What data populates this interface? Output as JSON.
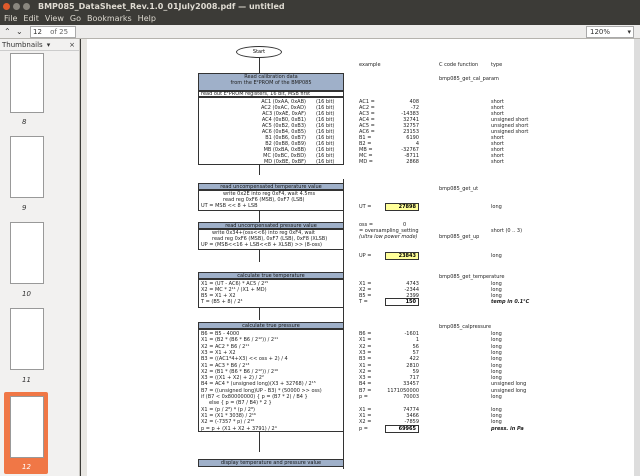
{
  "window": {
    "title": "BMP085_DataSheet_Rev.1.0_01July2008.pdf — untitled"
  },
  "menu": [
    "File",
    "Edit",
    "View",
    "Go",
    "Bookmarks",
    "Help"
  ],
  "toolbar": {
    "page": "12",
    "of": "of 25",
    "zoom": "120%"
  },
  "sidebar": {
    "title": "Thumbnails",
    "pages": [
      "8",
      "9",
      "10",
      "11",
      "12"
    ]
  },
  "doc": {
    "start": "Start",
    "cols": {
      "example": "example",
      "cfunc": "C code function",
      "type": "type"
    },
    "s1": {
      "h1": "Read calibration data",
      "h2": "from the E²PROM of the BMP085",
      "h3": "read out E²PROM registers, 16 bit, MSB first",
      "fn": "bmp085_get_cal_param",
      "rows": [
        [
          "AC1 (0xAA, 0xAB)",
          "(16 bit)",
          "AC1 =",
          "408",
          "short"
        ],
        [
          "AC2 (0xAC, 0xAD)",
          "(16 bit)",
          "AC2 =",
          "-72",
          "short"
        ],
        [
          "AC3 (0xAE, 0xAF)",
          "(16 bit)",
          "AC3 =",
          "-14383",
          "short"
        ],
        [
          "AC4 (0xB0, 0xB1)",
          "(16 bit)",
          "AC4 =",
          "32741",
          "unsigned short"
        ],
        [
          "AC5 (0xB2, 0xB3)",
          "(16 bit)",
          "AC5 =",
          "32757",
          "unsigned short"
        ],
        [
          "AC6 (0xB4, 0xB5)",
          "(16 bit)",
          "AC6 =",
          "23153",
          "unsigned short"
        ],
        [
          "B1 (0xB6, 0xB7)",
          "(16 bit)",
          "B1 =",
          "6190",
          "short"
        ],
        [
          "B2 (0xB8, 0xB9)",
          "(16 bit)",
          "B2 =",
          "4",
          "short"
        ],
        [
          "MB (0xBA, 0xBB)",
          "(16 bit)",
          "MB =",
          "-32767",
          "short"
        ],
        [
          "MC (0xBC, 0xBD)",
          "(16 bit)",
          "MC =",
          "-8711",
          "short"
        ],
        [
          "MD (0xBE, 0xBF)",
          "(16 bit)",
          "MD =",
          "2868",
          "short"
        ]
      ]
    },
    "s2": {
      "h": "read uncompensated temperature value",
      "l1": "write 0x2E into reg 0xF4, wait 4.5ms",
      "l2": "read reg 0xF6 (MSB), 0xF7 (LSB)",
      "l3": "UT = MSB << 8 + LSB",
      "fn": "bmp085_get_ut",
      "ut": "UT =",
      "utv": "27898",
      "type": "long"
    },
    "s3": {
      "h": "read uncompensated pressure value",
      "l1": "write 0x34+(oss<<6) into reg 0xF4, wait",
      "l2": "read reg 0xF6 (MSB), 0xF7 (LSB), 0xF8 (XLSB)",
      "l3": "UP = (MSB<<16 + LSB<<8 + XLSB) >> (8-oss)",
      "oss": "oss =",
      "ossv": "0",
      "ossnote1": "= oversampling_setting",
      "ossnote2": "(ultra low power mode)",
      "osstype": "short (0 .. 3)",
      "fn": "bmp085_get_up",
      "up": "UP =",
      "upv": "23843",
      "type": "long"
    },
    "s4": {
      "h": "calculate true temperature",
      "fn": "bmp085_get_temperature",
      "rows": [
        [
          "X1 = (UT - AC6) * AC5 / 2¹⁵",
          "X1 =",
          "4743",
          "long"
        ],
        [
          "X2 = MC * 2¹¹ / (X1 + MD)",
          "X2 =",
          "-2344",
          "long"
        ],
        [
          "B5 = X1 + X2",
          "B5 =",
          "2399",
          "long"
        ],
        [
          "T = (B5 + 8) / 2⁴",
          "T =",
          "150",
          "temp in 0.1°C"
        ]
      ]
    },
    "s5": {
      "h": "calculate true pressure",
      "fn": "bmp085_calpressure",
      "rows": [
        [
          "B6 = B5 - 4000",
          "B6 =",
          "-1601",
          "long"
        ],
        [
          "X1 = (B2 * (B6 * B6 / 2¹²)) / 2¹¹",
          "X1 =",
          "1",
          "long"
        ],
        [
          "X2 = AC2 * B6 / 2¹¹",
          "X2 =",
          "56",
          "long"
        ],
        [
          "X3 = X1 + X2",
          "X3 =",
          "57",
          "long"
        ],
        [
          "B3 = ((AC1*4+X3) << oss + 2) / 4",
          "B3 =",
          "422",
          "long"
        ],
        [
          "X1 = AC3 * B6 / 2¹³",
          "X1 =",
          "2810",
          "long"
        ],
        [
          "X2 = (B1 * (B6 * B6 / 2¹²)) / 2¹⁶",
          "X2 =",
          "59",
          "long"
        ],
        [
          "X3 = ((X1 + X2) + 2) / 2²",
          "X3 =",
          "717",
          "long"
        ],
        [
          "B4 = AC4 * (unsigned long)(X3 + 32768) / 2¹⁵",
          "B4 =",
          "33457",
          "unsigned long"
        ],
        [
          "B7 = ((unsigned long)UP - B3) * (50000 >> oss)",
          "B7 =",
          "1171050000",
          "unsigned long"
        ],
        [
          "if (B7 < 0x80000000) { p = (B7 * 2) / B4 }",
          "p =",
          "70003",
          "long"
        ],
        [
          "else { p = (B7 / B4) * 2 }",
          "",
          "",
          ""
        ],
        [
          "X1 = (p / 2⁸) * (p / 2⁸)",
          "X1 =",
          "74774",
          "long"
        ],
        [
          "X1 = (X1 * 3038) / 2¹⁶",
          "X1 =",
          "3466",
          "long"
        ],
        [
          "X2 = (-7357 * p) / 2¹⁶",
          "X2 =",
          "-7859",
          "long"
        ],
        [
          "p = p + (X1 + X2 + 3791) / 2⁴",
          "p =",
          "69965",
          "press. in Pa"
        ]
      ]
    },
    "s6": {
      "h": "display temperature and pressure value"
    }
  }
}
